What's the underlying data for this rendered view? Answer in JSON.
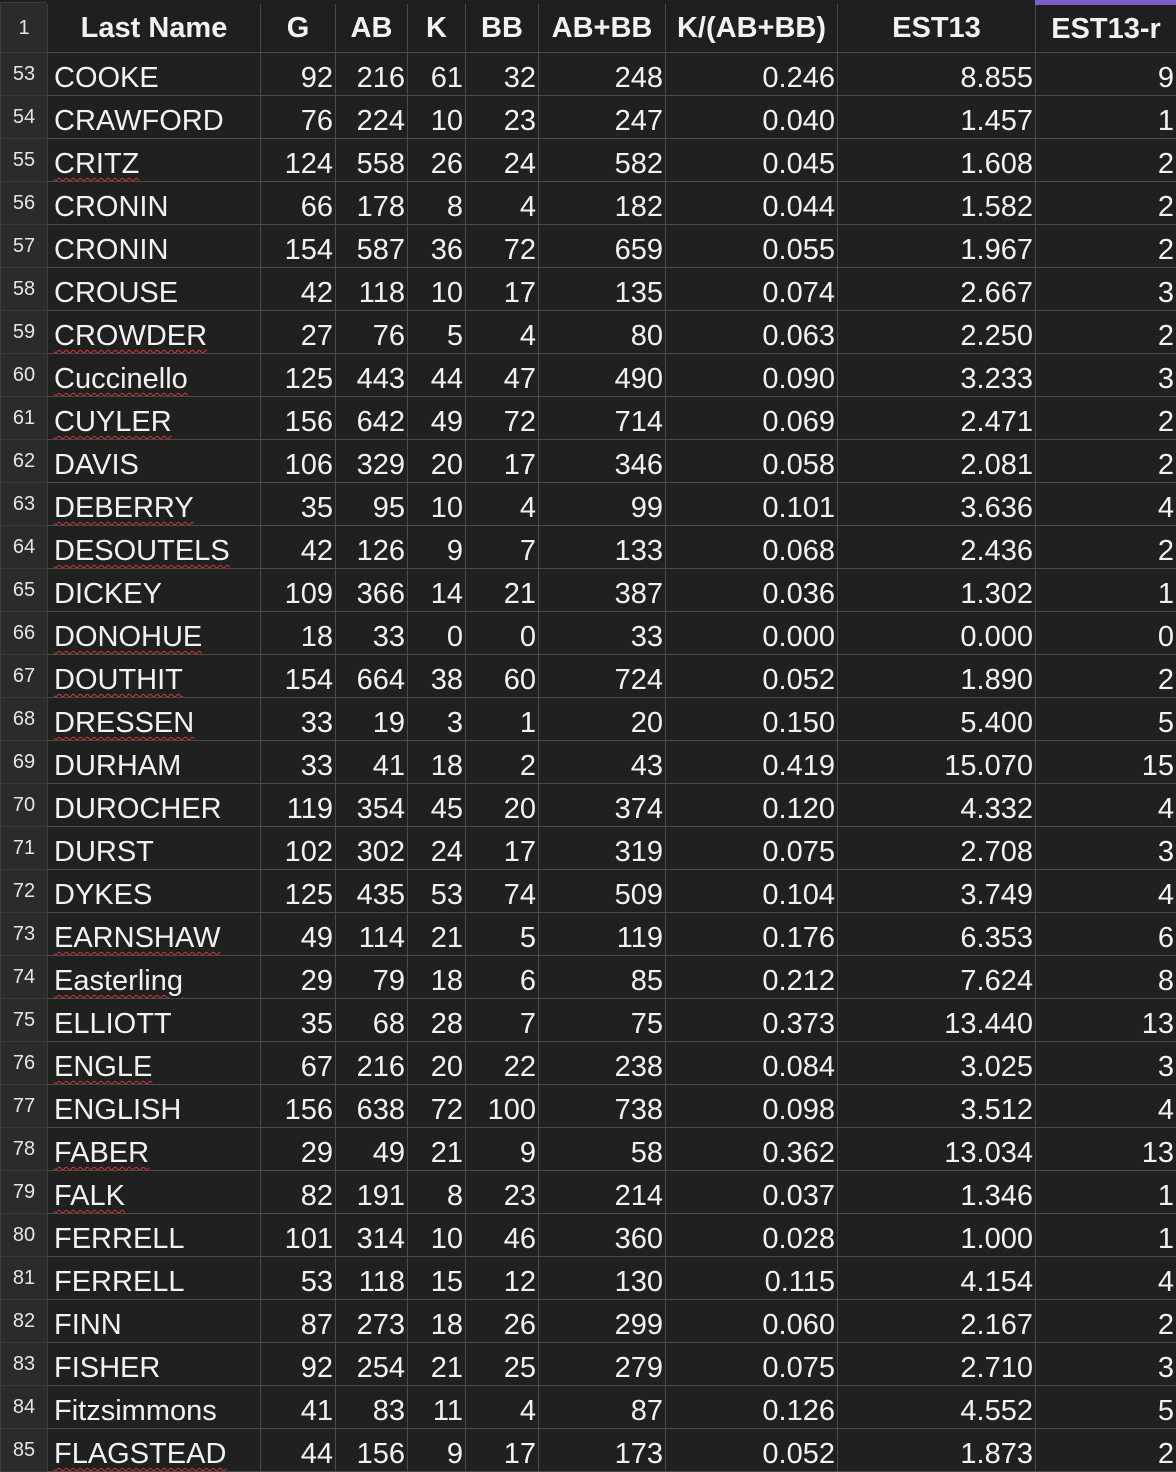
{
  "header": {
    "row_number": "1",
    "columns": [
      "Last Name",
      "G",
      "AB",
      "K",
      "BB",
      "AB+BB",
      "K/(AB+BB)",
      "EST13",
      "EST13-r"
    ]
  },
  "rows": [
    {
      "n": "53",
      "name": "COOKE",
      "g": "92",
      "ab": "216",
      "k": "61",
      "bb": "32",
      "abbb": "248",
      "kr": "0.246",
      "est": "8.855",
      "estr": "9"
    },
    {
      "n": "54",
      "name": "CRAWFORD",
      "g": "76",
      "ab": "224",
      "k": "10",
      "bb": "23",
      "abbb": "247",
      "kr": "0.040",
      "est": "1.457",
      "estr": "1"
    },
    {
      "n": "55",
      "name": "CRITZ",
      "g": "124",
      "ab": "558",
      "k": "26",
      "bb": "24",
      "abbb": "582",
      "kr": "0.045",
      "est": "1.608",
      "estr": "2"
    },
    {
      "n": "56",
      "name": "CRONIN",
      "g": "66",
      "ab": "178",
      "k": "8",
      "bb": "4",
      "abbb": "182",
      "kr": "0.044",
      "est": "1.582",
      "estr": "2"
    },
    {
      "n": "57",
      "name": "CRONIN",
      "g": "154",
      "ab": "587",
      "k": "36",
      "bb": "72",
      "abbb": "659",
      "kr": "0.055",
      "est": "1.967",
      "estr": "2"
    },
    {
      "n": "58",
      "name": "CROUSE",
      "g": "42",
      "ab": "118",
      "k": "10",
      "bb": "17",
      "abbb": "135",
      "kr": "0.074",
      "est": "2.667",
      "estr": "3"
    },
    {
      "n": "59",
      "name": "CROWDER",
      "g": "27",
      "ab": "76",
      "k": "5",
      "bb": "4",
      "abbb": "80",
      "kr": "0.063",
      "est": "2.250",
      "estr": "2"
    },
    {
      "n": "60",
      "name": "Cuccinello",
      "g": "125",
      "ab": "443",
      "k": "44",
      "bb": "47",
      "abbb": "490",
      "kr": "0.090",
      "est": "3.233",
      "estr": "3"
    },
    {
      "n": "61",
      "name": "CUYLER",
      "g": "156",
      "ab": "642",
      "k": "49",
      "bb": "72",
      "abbb": "714",
      "kr": "0.069",
      "est": "2.471",
      "estr": "2"
    },
    {
      "n": "62",
      "name": "DAVIS",
      "g": "106",
      "ab": "329",
      "k": "20",
      "bb": "17",
      "abbb": "346",
      "kr": "0.058",
      "est": "2.081",
      "estr": "2"
    },
    {
      "n": "63",
      "name": "DEBERRY",
      "g": "35",
      "ab": "95",
      "k": "10",
      "bb": "4",
      "abbb": "99",
      "kr": "0.101",
      "est": "3.636",
      "estr": "4"
    },
    {
      "n": "64",
      "name": "DESOUTELS",
      "g": "42",
      "ab": "126",
      "k": "9",
      "bb": "7",
      "abbb": "133",
      "kr": "0.068",
      "est": "2.436",
      "estr": "2"
    },
    {
      "n": "65",
      "name": "DICKEY",
      "g": "109",
      "ab": "366",
      "k": "14",
      "bb": "21",
      "abbb": "387",
      "kr": "0.036",
      "est": "1.302",
      "estr": "1"
    },
    {
      "n": "66",
      "name": "DONOHUE",
      "g": "18",
      "ab": "33",
      "k": "0",
      "bb": "0",
      "abbb": "33",
      "kr": "0.000",
      "est": "0.000",
      "estr": "0"
    },
    {
      "n": "67",
      "name": "DOUTHIT",
      "g": "154",
      "ab": "664",
      "k": "38",
      "bb": "60",
      "abbb": "724",
      "kr": "0.052",
      "est": "1.890",
      "estr": "2"
    },
    {
      "n": "68",
      "name": "DRESSEN",
      "g": "33",
      "ab": "19",
      "k": "3",
      "bb": "1",
      "abbb": "20",
      "kr": "0.150",
      "est": "5.400",
      "estr": "5"
    },
    {
      "n": "69",
      "name": "DURHAM",
      "g": "33",
      "ab": "41",
      "k": "18",
      "bb": "2",
      "abbb": "43",
      "kr": "0.419",
      "est": "15.070",
      "estr": "15"
    },
    {
      "n": "70",
      "name": "DUROCHER",
      "g": "119",
      "ab": "354",
      "k": "45",
      "bb": "20",
      "abbb": "374",
      "kr": "0.120",
      "est": "4.332",
      "estr": "4"
    },
    {
      "n": "71",
      "name": "DURST",
      "g": "102",
      "ab": "302",
      "k": "24",
      "bb": "17",
      "abbb": "319",
      "kr": "0.075",
      "est": "2.708",
      "estr": "3"
    },
    {
      "n": "72",
      "name": "DYKES",
      "g": "125",
      "ab": "435",
      "k": "53",
      "bb": "74",
      "abbb": "509",
      "kr": "0.104",
      "est": "3.749",
      "estr": "4"
    },
    {
      "n": "73",
      "name": "EARNSHAW",
      "g": "49",
      "ab": "114",
      "k": "21",
      "bb": "5",
      "abbb": "119",
      "kr": "0.176",
      "est": "6.353",
      "estr": "6"
    },
    {
      "n": "74",
      "name": "Easterling",
      "g": "29",
      "ab": "79",
      "k": "18",
      "bb": "6",
      "abbb": "85",
      "kr": "0.212",
      "est": "7.624",
      "estr": "8"
    },
    {
      "n": "75",
      "name": "ELLIOTT",
      "g": "35",
      "ab": "68",
      "k": "28",
      "bb": "7",
      "abbb": "75",
      "kr": "0.373",
      "est": "13.440",
      "estr": "13"
    },
    {
      "n": "76",
      "name": "ENGLE",
      "g": "67",
      "ab": "216",
      "k": "20",
      "bb": "22",
      "abbb": "238",
      "kr": "0.084",
      "est": "3.025",
      "estr": "3"
    },
    {
      "n": "77",
      "name": "ENGLISH",
      "g": "156",
      "ab": "638",
      "k": "72",
      "bb": "100",
      "abbb": "738",
      "kr": "0.098",
      "est": "3.512",
      "estr": "4"
    },
    {
      "n": "78",
      "name": "FABER",
      "g": "29",
      "ab": "49",
      "k": "21",
      "bb": "9",
      "abbb": "58",
      "kr": "0.362",
      "est": "13.034",
      "estr": "13"
    },
    {
      "n": "79",
      "name": "FALK",
      "g": "82",
      "ab": "191",
      "k": "8",
      "bb": "23",
      "abbb": "214",
      "kr": "0.037",
      "est": "1.346",
      "estr": "1"
    },
    {
      "n": "80",
      "name": "FERRELL",
      "g": "101",
      "ab": "314",
      "k": "10",
      "bb": "46",
      "abbb": "360",
      "kr": "0.028",
      "est": "1.000",
      "estr": "1"
    },
    {
      "n": "81",
      "name": "FERRELL",
      "g": "53",
      "ab": "118",
      "k": "15",
      "bb": "12",
      "abbb": "130",
      "kr": "0.115",
      "est": "4.154",
      "estr": "4"
    },
    {
      "n": "82",
      "name": "FINN",
      "g": "87",
      "ab": "273",
      "k": "18",
      "bb": "26",
      "abbb": "299",
      "kr": "0.060",
      "est": "2.167",
      "estr": "2"
    },
    {
      "n": "83",
      "name": "FISHER",
      "g": "92",
      "ab": "254",
      "k": "21",
      "bb": "25",
      "abbb": "279",
      "kr": "0.075",
      "est": "2.710",
      "estr": "3"
    },
    {
      "n": "84",
      "name": "Fitzsimmons",
      "g": "41",
      "ab": "83",
      "k": "11",
      "bb": "4",
      "abbb": "87",
      "kr": "0.126",
      "est": "4.552",
      "estr": "5"
    },
    {
      "n": "85",
      "name": "FLAGSTEAD",
      "g": "44",
      "ab": "156",
      "k": "9",
      "bb": "17",
      "abbb": "173",
      "kr": "0.052",
      "est": "1.873",
      "estr": "2"
    }
  ],
  "colors": {
    "background": "#202020",
    "header_row_bg": "#2b2b2b",
    "grid_line": "#4a4a4a",
    "text": "#f2f2f2",
    "selected_column_accent": "#7b5fc7",
    "spellcheck_underline": "#dd3333"
  },
  "spellcheck_flagged": [
    "CRITZ",
    "CROWDER",
    "Cuccinello",
    "CUYLER",
    "DEBERRY",
    "DESOUTELS",
    "DONOHUE",
    "DOUTHIT",
    "DRESSEN",
    "EARNSHAW",
    "Easterling",
    "ENGLE",
    "FABER",
    "FALK",
    "FLAGSTEAD"
  ]
}
